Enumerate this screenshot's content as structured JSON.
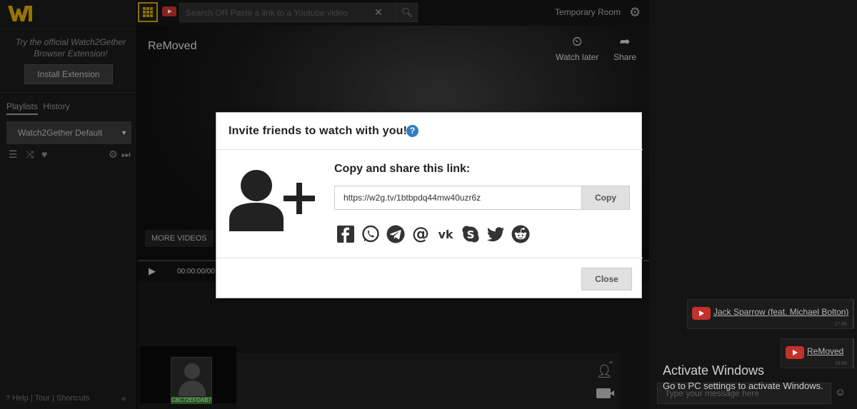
{
  "sidebar": {
    "promo_text": "Try the official Watch2Gether Browser Extension!",
    "install_label": "Install Extension",
    "tabs": [
      {
        "label": "Playlists"
      },
      {
        "label": "History"
      }
    ],
    "playlist_selected": "Watch2Gether Default",
    "footer": {
      "help": "Help",
      "tour": "Tour",
      "shortcuts": "Shortcuts",
      "sep": "|"
    }
  },
  "topbar": {
    "search_placeholder": "Search OR Paste a link to a Youtube video",
    "room_name": "Temporary Room"
  },
  "video": {
    "title": "ReMoved",
    "watch_later": "Watch later",
    "share": "Share",
    "more_videos": "MORE VIDEOS",
    "time": "00:00:00/00:"
  },
  "lower": {
    "user_tag": "C8C72EFDAB7"
  },
  "chat": {
    "messages": [
      {
        "title": "Jack Sparrow (feat. Michael Bolton)",
        "time": "17:45"
      },
      {
        "title": "ReMoved",
        "time": "18:06"
      }
    ],
    "input_placeholder": "Type your message here"
  },
  "activate": {
    "title": "Activate Windows",
    "subtitle": "Go to PC settings to activate Windows."
  },
  "modal": {
    "title": "Invite friends to watch with you!",
    "copy_label": "Copy and share this link:",
    "link": "https://w2g.tv/1btbpdq44mw40uzr6z",
    "copy_button": "Copy",
    "close_button": "Close",
    "share_targets": [
      "facebook",
      "whatsapp",
      "telegram",
      "email",
      "vk",
      "skype",
      "twitter",
      "reddit"
    ]
  },
  "colors": {
    "accent": "#c9a300",
    "help_blue": "#2f7fc4",
    "youtube_red": "#c4302b"
  }
}
